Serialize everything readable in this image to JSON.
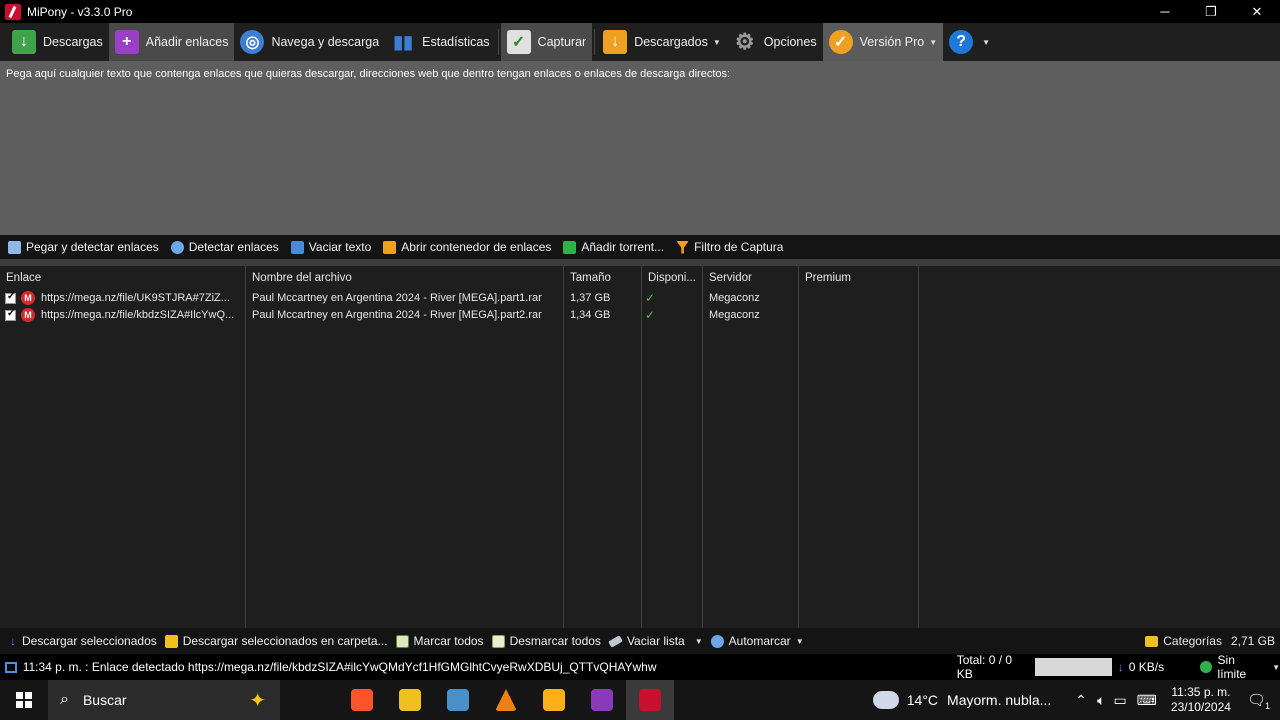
{
  "window": {
    "title": "MiPony - v3.3.0 Pro",
    "controls": {
      "minimize": "─",
      "maximize": "❐",
      "close": "✕"
    }
  },
  "toolbar": {
    "items": [
      {
        "label": "Descargas",
        "icon": "download-arrow-icon",
        "color": "#3fa34d"
      },
      {
        "label": "Añadir enlaces",
        "icon": "plus-icon",
        "color": "#9b3fc6"
      },
      {
        "label": "Navega y descarga",
        "icon": "globe-icon",
        "color": "#3b7fd4"
      },
      {
        "label": "Estadísticas",
        "icon": "bar-chart-icon",
        "color": "#3b7fd4"
      },
      {
        "label": "Capturar",
        "icon": "clipboard-check-icon",
        "color": "#e0e0e0"
      },
      {
        "label": "Descargados",
        "icon": "folder-download-icon",
        "color": "#f0a020"
      },
      {
        "label": "Opciones",
        "icon": "gear-icon",
        "color": "#8a8a8a"
      },
      {
        "label": "Versión Pro",
        "icon": "medal-icon",
        "color": "#f0a020"
      }
    ],
    "help_icon": "?"
  },
  "paste_area": {
    "text": "Pega aquí cualquier texto que contenga enlaces que quieras descargar, direcciones web que dentro tengan enlaces o enlaces de descarga directos:"
  },
  "actions": {
    "paste_detect": "Pegar y detectar enlaces",
    "detect": "Detectar enlaces",
    "clear_text": "Vaciar texto",
    "open_container": "Abrir contenedor de enlaces",
    "add_torrent": "Añadir torrent...",
    "capture_filter": "Filtro de Captura"
  },
  "table": {
    "headers": [
      "Enlace",
      "Nombre del archivo",
      "Tamaño",
      "Disponi...",
      "Servidor",
      "Premium"
    ],
    "rows": [
      {
        "link": "https://mega.nz/file/UK9STJRA#7ZiZ...",
        "name": "Paul Mccartney en Argentina 2024 - River [MEGA].part1.rar",
        "size": "1,37 GB",
        "available": "✓",
        "server": "Megaconz",
        "premium": ""
      },
      {
        "link": "https://mega.nz/file/kbdzSIZA#IlcYwQ...",
        "name": "Paul Mccartney en Argentina 2024 - River [MEGA].part2.rar",
        "size": "1,34 GB",
        "available": "✓",
        "server": "Megaconz",
        "premium": ""
      }
    ],
    "host_badge": "M"
  },
  "bottom_actions": {
    "download_selected": "Descargar seleccionados",
    "download_to_folder": "Descargar seleccionados en carpeta...",
    "mark_all": "Marcar todos",
    "unmark_all": "Desmarcar todos",
    "clear_list": "Vaciar lista",
    "automark": "Automarcar",
    "categories": "Categorías",
    "total_size": "2,71 GB"
  },
  "status": {
    "log": "11:34 p. m. : Enlace detectado https://mega.nz/file/kbdzSIZA#ilcYwQMdYcf1HfGMGlhtCvyeRwXDBUj_QTTvQHAYwhw",
    "total": "Total: 0 / 0 KB",
    "speed": "0 KB/s",
    "limit": "Sin límite"
  },
  "taskbar": {
    "search_placeholder": "Buscar",
    "weather_temp": "14°C",
    "weather_desc": "Mayorm. nubla...",
    "time": "11:35 p. m.",
    "date": "23/10/2024",
    "notification_count": "1"
  }
}
